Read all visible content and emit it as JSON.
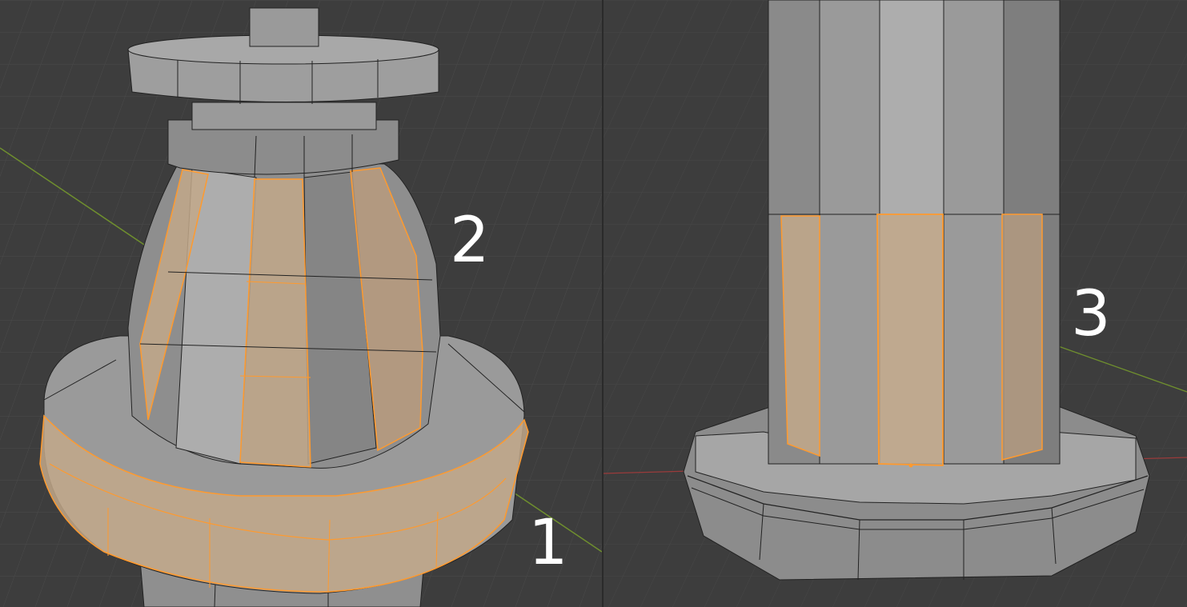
{
  "labels": {
    "one": "1",
    "two": "2",
    "three": "3"
  },
  "colors": {
    "background": "#3d3d3d",
    "grid": "#4a4a4a",
    "mesh_face": "#9c9c9c",
    "mesh_edge": "#222222",
    "selected_face": "#c2a88a",
    "selected_edge": "#ff9a2e",
    "axis_y": "#6f8f2e",
    "axis_x": "#9a3b3b"
  }
}
